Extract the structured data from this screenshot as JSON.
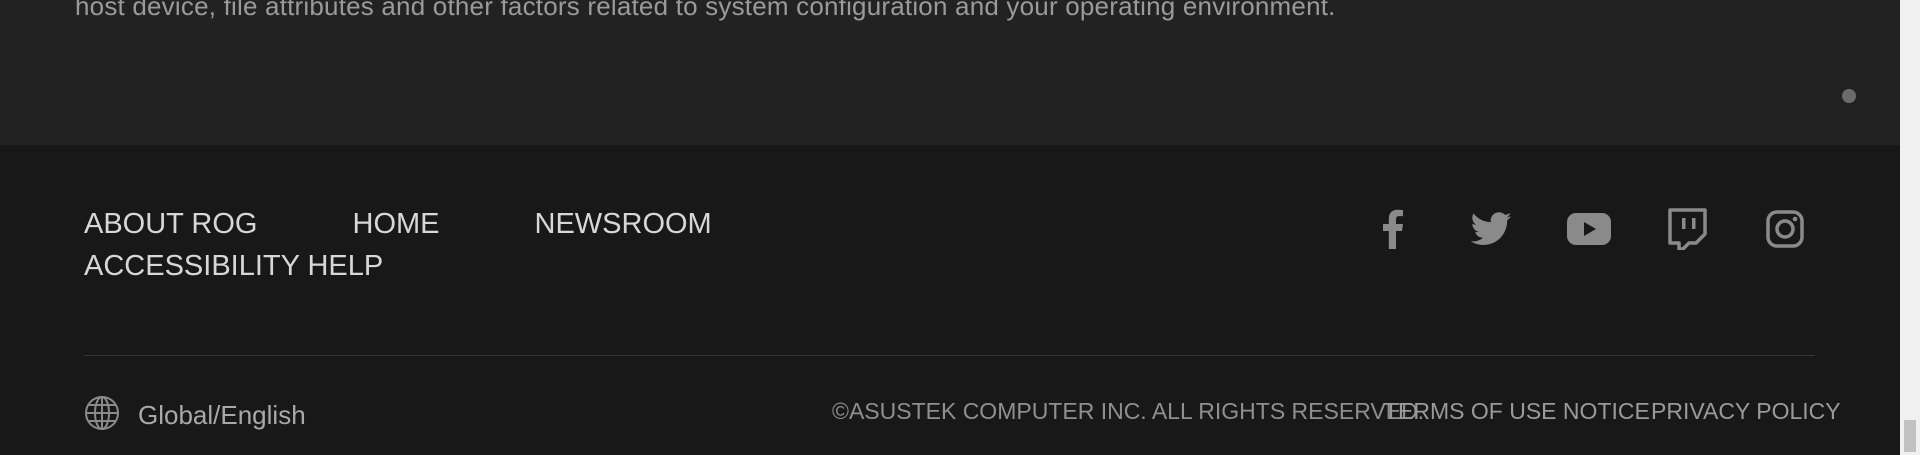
{
  "content": {
    "disclaimer_text": "host device, file attributes and other factors related to system configuration and your operating environment."
  },
  "footer": {
    "nav_links": [
      "ABOUT ROG",
      "HOME",
      "NEWSROOM"
    ],
    "accessibility_link": "ACCESSIBILITY HELP",
    "social": [
      "facebook-icon",
      "twitter-icon",
      "youtube-icon",
      "twitch-icon",
      "instagram-icon"
    ],
    "locale_label": "Global/English",
    "copyright": "©ASUSTEK COMPUTER INC. ALL RIGHTS RESERVED.",
    "terms_link": "TERMS OF USE NOTICE",
    "privacy_link": "PRIVACY POLICY"
  },
  "colors": {
    "content_background": "#222222",
    "footer_background": "#181818",
    "link_text": "#d7d7d7",
    "icon": "#8a8a8a"
  }
}
